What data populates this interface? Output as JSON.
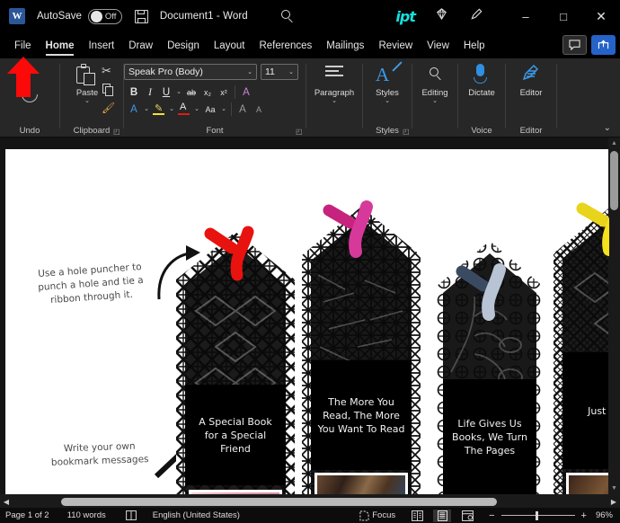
{
  "titlebar": {
    "app_icon": "word-icon",
    "autosave_label": "AutoSave",
    "autosave_state": "Off",
    "save_icon": "save-icon",
    "document_title": "Document1  -  Word",
    "search_icon": "search-icon",
    "brand_logo": "ipt",
    "diamond_icon": "diamond-icon",
    "pen_icon": "pen-edit-icon",
    "minimize": "–",
    "maximize": "□",
    "close": "✕"
  },
  "tabs": [
    {
      "label": "File",
      "active": false
    },
    {
      "label": "Home",
      "active": true
    },
    {
      "label": "Insert",
      "active": false
    },
    {
      "label": "Draw",
      "active": false
    },
    {
      "label": "Design",
      "active": false
    },
    {
      "label": "Layout",
      "active": false
    },
    {
      "label": "References",
      "active": false
    },
    {
      "label": "Mailings",
      "active": false
    },
    {
      "label": "Review",
      "active": false
    },
    {
      "label": "View",
      "active": false
    },
    {
      "label": "Help",
      "active": false
    }
  ],
  "tab_actions": {
    "comments_icon": "comment-icon",
    "share_icon": "share-icon"
  },
  "ribbon": {
    "groups": [
      {
        "name": "Undo",
        "label": "Undo"
      },
      {
        "name": "Clipboard",
        "label": "Clipboard"
      },
      {
        "name": "Font",
        "label": "Font"
      },
      {
        "name": "Paragraph",
        "label": "Paragraph"
      },
      {
        "name": "Styles",
        "label": "Styles"
      },
      {
        "name": "Editing",
        "label": "Editing"
      },
      {
        "name": "Voice",
        "label": "Voice"
      },
      {
        "name": "Editor",
        "label": "Editor"
      }
    ],
    "clipboard": {
      "paste_label": "Paste",
      "cut_icon": "scissors-icon",
      "copy_icon": "copy-icon",
      "format_painter_icon": "format-painter-icon"
    },
    "font": {
      "font_name": "Speak Pro (Body)",
      "font_size": "11",
      "bold": "B",
      "italic": "I",
      "underline": "U",
      "strikethrough": "ab",
      "subscript": "x₂",
      "superscript": "x²",
      "clear_formatting_icon": "clear-formatting-icon",
      "text_effects_icon": "text-effects-icon",
      "highlight_icon": "highlight-icon",
      "font_color_icon": "font-color-icon",
      "change_case": "Aa",
      "grow_font": "A",
      "shrink_font": "A"
    },
    "paragraph": {
      "label": "Paragraph"
    },
    "styles": {
      "label": "Styles"
    },
    "editing": {
      "label": "Editing"
    },
    "voice": {
      "label": "Dictate"
    },
    "editor": {
      "label": "Editor"
    },
    "collapse_icon": "chevron-down-icon"
  },
  "overlay": {
    "pointer_color": "#fb0a09",
    "pointer_target": "File",
    "pointer_name": "red-up-arrow-pointer"
  },
  "document": {
    "notes": [
      "Use a hole puncher to punch a hole and tie a ribbon through it.",
      "Write your own bookmark messages"
    ],
    "bookmarks": [
      {
        "caption": "A Special Book for a Special Friend",
        "ribbon_color": "#e8120f",
        "pattern": "cube-geometric"
      },
      {
        "caption": "The More You Read, The More You Want To Read",
        "ribbon_color": "#d7399b",
        "pattern": "scribble-lines"
      },
      {
        "caption": "Life Gives Us Books, We Turn The Pages",
        "ribbon_color": "#b8c4d4",
        "pattern": "floral-line"
      },
      {
        "caption": "Just On Pa",
        "ribbon_color": "#f5e11c",
        "pattern": "hex-geometric"
      }
    ]
  },
  "statusbar": {
    "page": "Page 1 of 2",
    "words": "110 words",
    "proofing_icon": "proofing-icon",
    "language": "English (United States)",
    "focus_icon": "focus-icon",
    "focus_label": "Focus",
    "read_mode_icon": "read-mode-icon",
    "print_layout_icon": "print-layout-icon",
    "web_layout_icon": "web-layout-icon",
    "zoom_out": "−",
    "zoom_in": "+",
    "zoom_level": "96%"
  },
  "scrollbars": {
    "vertical_up": "▲",
    "vertical_down": "▼",
    "horizontal_left": "◀",
    "horizontal_right": "▶"
  }
}
